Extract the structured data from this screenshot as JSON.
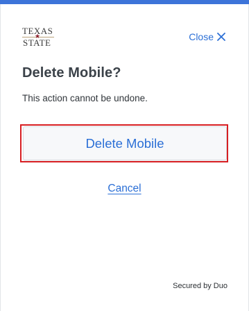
{
  "logo": {
    "line1": "TEXAS",
    "line2": "STATE",
    "star": "★",
    "colors": {
      "text": "#3a3a3a",
      "star": "#8b1c2c"
    }
  },
  "header": {
    "close_label": "Close"
  },
  "dialog": {
    "title": "Delete Mobile?",
    "message": "This action cannot be undone.",
    "delete_label": "Delete Mobile",
    "cancel_label": "Cancel"
  },
  "footer": {
    "text": "Secured by Duo"
  },
  "colors": {
    "accent": "#2b6fd6",
    "top_bar": "#3d74d9",
    "danger_outline": "#d71e22",
    "title": "#3b4249"
  },
  "icons": {
    "close": "close-x-icon"
  }
}
